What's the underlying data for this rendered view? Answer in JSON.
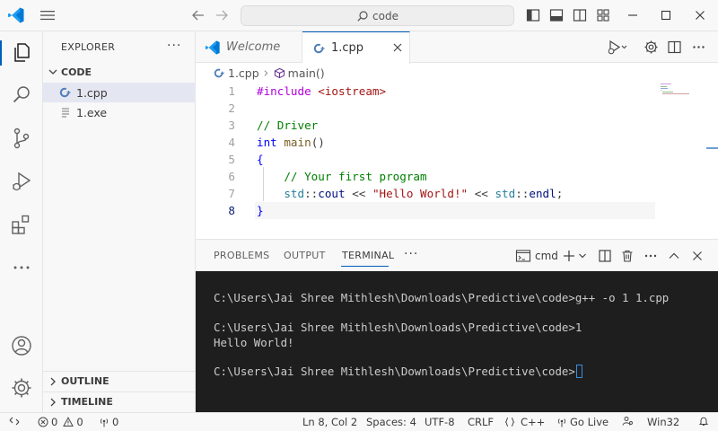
{
  "colors": {
    "accent": "#005fb8",
    "terminal_bg": "#1e1e1e",
    "vscode_blue": "#0078d4"
  },
  "titlebar": {
    "search_text": "code"
  },
  "sidebar": {
    "title": "EXPLORER",
    "more": "···",
    "folder": "CODE",
    "files": [
      {
        "name": "1.cpp",
        "icon": "cpp-file-icon"
      },
      {
        "name": "1.exe",
        "icon": "file-lines-icon"
      }
    ],
    "outline": "OUTLINE",
    "timeline": "TIMELINE"
  },
  "tabs": {
    "welcome": "Welcome",
    "active": "1.cpp"
  },
  "breadcrumb": {
    "file": "1.cpp",
    "symbol": "main()"
  },
  "code": {
    "current_line": 8,
    "lines": [
      {
        "n": "1",
        "parts": [
          [
            "pp",
            "#include "
          ],
          [
            "inc",
            "<iostream>"
          ]
        ]
      },
      {
        "n": "2",
        "parts": []
      },
      {
        "n": "3",
        "parts": [
          [
            "cm",
            "// Driver"
          ]
        ]
      },
      {
        "n": "4",
        "parts": [
          [
            "kw",
            "int"
          ],
          [
            "pl",
            " "
          ],
          [
            "fn",
            "main"
          ],
          [
            "pl",
            "()"
          ]
        ]
      },
      {
        "n": "5",
        "parts": [
          [
            "kw",
            "{"
          ]
        ]
      },
      {
        "n": "6",
        "parts": [
          [
            "pl",
            "    "
          ],
          [
            "cm",
            "// Your first program"
          ]
        ]
      },
      {
        "n": "7",
        "parts": [
          [
            "pl",
            "    "
          ],
          [
            "ns",
            "std"
          ],
          [
            "op",
            "::"
          ],
          [
            "id",
            "cout"
          ],
          [
            "op",
            " << "
          ],
          [
            "str",
            "\"Hello World!\""
          ],
          [
            "op",
            " << "
          ],
          [
            "ns",
            "std"
          ],
          [
            "op",
            "::"
          ],
          [
            "id",
            "endl"
          ],
          [
            "pl",
            ";"
          ]
        ]
      },
      {
        "n": "8",
        "parts": [
          [
            "kw",
            "}"
          ]
        ]
      }
    ]
  },
  "panel": {
    "tabs": [
      "PROBLEMS",
      "OUTPUT",
      "TERMINAL"
    ],
    "active_tab": "TERMINAL",
    "more": "···",
    "shell": "cmd"
  },
  "terminal": {
    "lines": [
      "C:\\Users\\Jai Shree Mithlesh\\Downloads\\Predictive\\code>g++ -o 1 1.cpp",
      "C:\\Users\\Jai Shree Mithlesh\\Downloads\\Predictive\\code>1",
      "Hello World!",
      "C:\\Users\\Jai Shree Mithlesh\\Downloads\\Predictive\\code>"
    ]
  },
  "status": {
    "errors": "0",
    "warnings": "0",
    "ports": "0",
    "position": "Ln 8, Col 2",
    "spaces": "Spaces: 4",
    "encoding": "UTF-8",
    "eol": "CRLF",
    "language": "C++",
    "golive": "Go Live",
    "platform": "Win32"
  }
}
